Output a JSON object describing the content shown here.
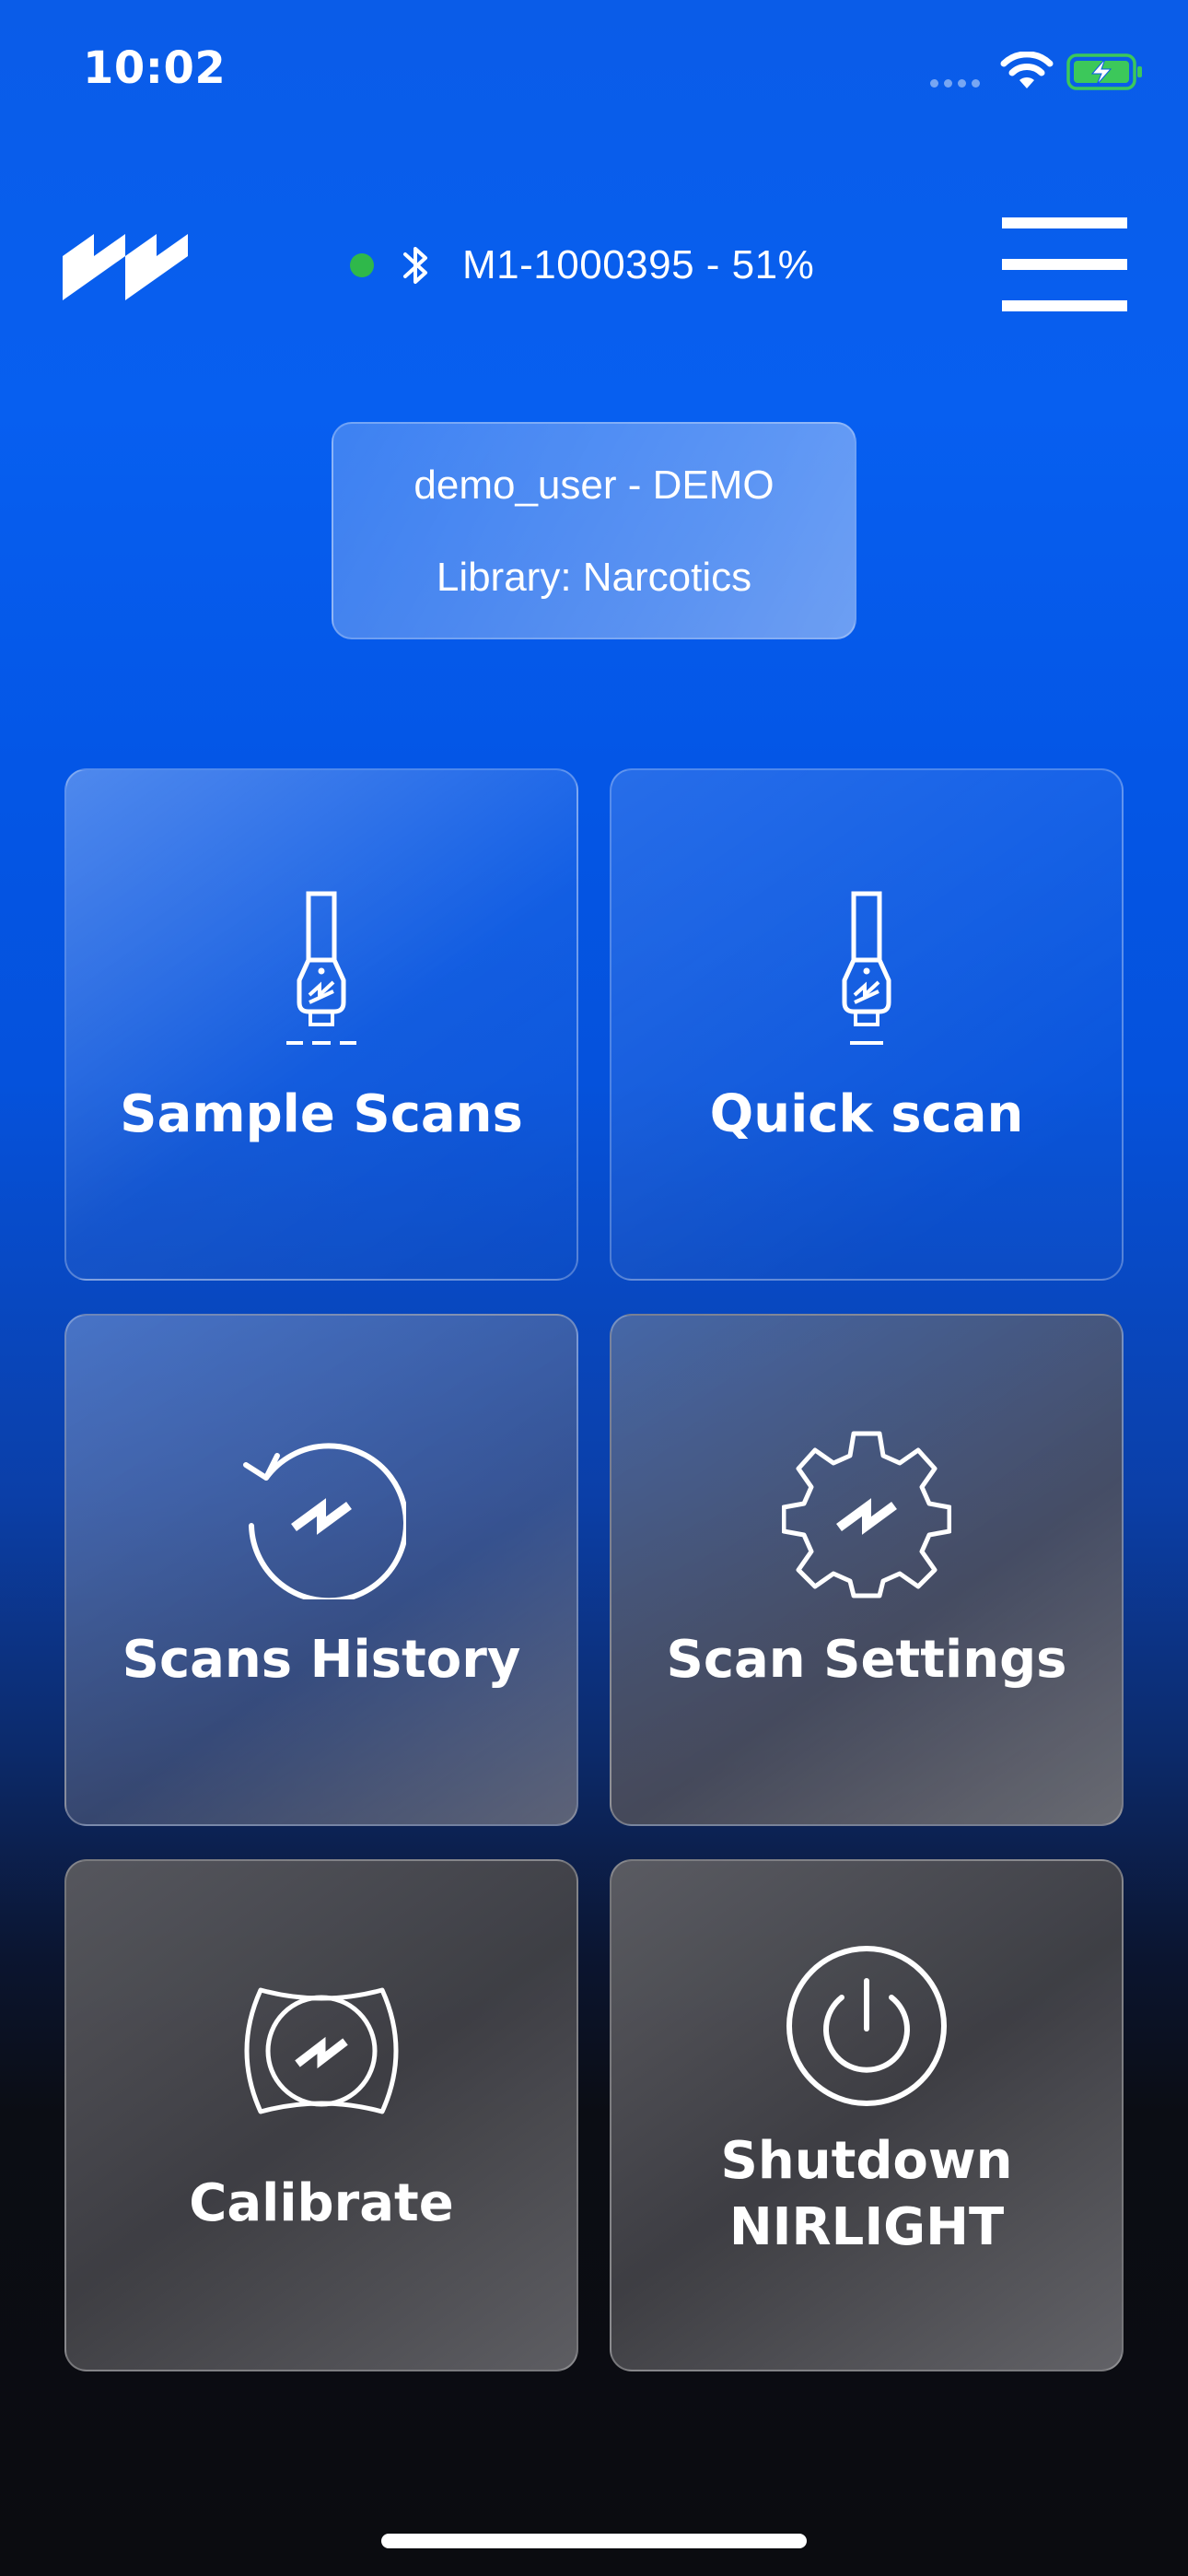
{
  "status_bar": {
    "time": "10:02"
  },
  "header": {
    "device_label": "M1-1000395 - 51%"
  },
  "user_panel": {
    "user_line": "demo_user - DEMO",
    "library_line": "Library: Narcotics"
  },
  "tiles": [
    {
      "label": "Sample Scans",
      "icon": "scanner-icon"
    },
    {
      "label": "Quick scan",
      "icon": "scanner-icon"
    },
    {
      "label": "Scans History",
      "icon": "history-icon"
    },
    {
      "label": "Scan Settings",
      "icon": "gear-icon"
    },
    {
      "label": "Calibrate",
      "icon": "calibrate-icon"
    },
    {
      "label": "Shutdown\nNIRLIGHT",
      "icon": "power-icon"
    }
  ],
  "colors": {
    "accent_blue": "#075FF0",
    "connected_green": "#2FB84A",
    "battery_green": "#3CC85A"
  }
}
